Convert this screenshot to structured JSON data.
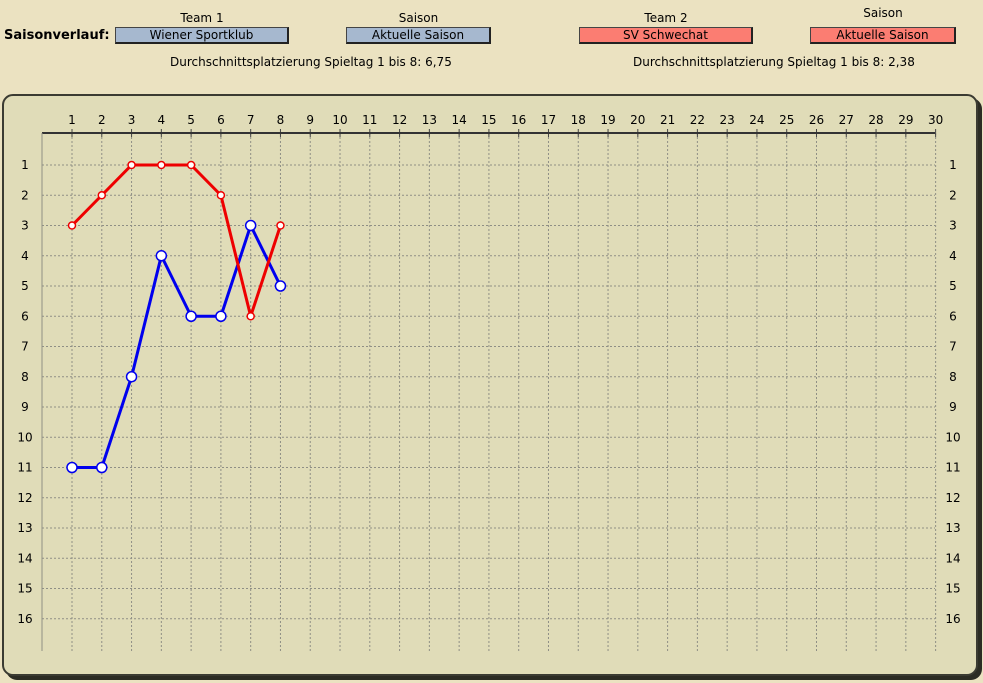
{
  "header": {
    "title": "Saisonverlauf:",
    "team1_label": "Team 1",
    "team1_value": "Wiener Sportklub",
    "season1_label": "Saison",
    "season1_value": "Aktuelle Saison",
    "team2_label": "Team 2",
    "team2_value": "SV Schwechat",
    "season2_label": "Saison",
    "season2_value": "Aktuelle Saison",
    "avg1_text": "Durchschnittsplatzierung Spieltag 1 bis 8:  6,75",
    "avg2_text": "Durchschnittsplatzierung Spieltag 1 bis 8:  2,38"
  },
  "colors": {
    "team1": "#0000ee",
    "team2": "#ee0000",
    "team1_button": "#a6b8cf",
    "team2_button": "#fb7d72"
  },
  "chart_data": {
    "type": "line",
    "x": [
      1,
      2,
      3,
      4,
      5,
      6,
      7,
      8,
      9,
      10,
      11,
      12,
      13,
      14,
      15,
      16,
      17,
      18,
      19,
      20,
      21,
      22,
      23,
      24,
      25,
      26,
      27,
      28,
      29,
      30
    ],
    "y_ticks": [
      1,
      2,
      3,
      4,
      5,
      6,
      7,
      8,
      9,
      10,
      11,
      12,
      13,
      14,
      15,
      16
    ],
    "xlim": [
      1,
      30
    ],
    "ylim": [
      1,
      16
    ],
    "y_inverted": true,
    "grid": true,
    "series": [
      {
        "name": "Wiener Sportklub",
        "color": "#0000ee",
        "x": [
          1,
          2,
          3,
          4,
          5,
          6,
          7,
          8
        ],
        "values": [
          11,
          11,
          8,
          4,
          6,
          6,
          3,
          5
        ]
      },
      {
        "name": "SV Schwechat",
        "color": "#ee0000",
        "x": [
          1,
          2,
          3,
          4,
          5,
          6,
          7,
          8
        ],
        "values": [
          3,
          2,
          1,
          1,
          1,
          2,
          6,
          3
        ]
      }
    ]
  }
}
